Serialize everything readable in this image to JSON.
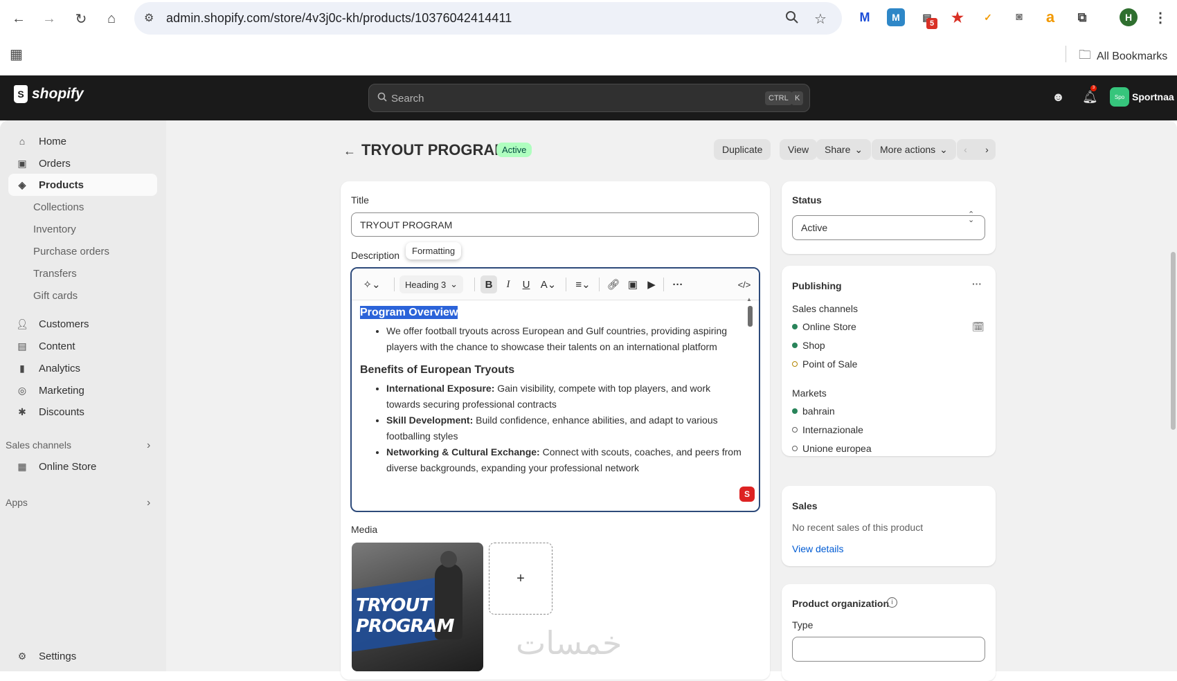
{
  "browser": {
    "url": "admin.shopify.com/store/4v3j0c-kh/products/10376042414411",
    "bookmarks_label": "All Bookmarks",
    "profile_initial": "H",
    "ext_badge": "5"
  },
  "topbar": {
    "brand": "shopify",
    "search_placeholder": "Search",
    "kbd_ctrl": "CTRL",
    "kbd_k": "K",
    "store_avatar": "Spo",
    "store_name": "Sportnaa",
    "notif_count": "3"
  },
  "sidebar": {
    "items": [
      {
        "label": "Home",
        "icon": "home-icon"
      },
      {
        "label": "Orders",
        "icon": "orders-icon"
      },
      {
        "label": "Products",
        "icon": "tag-icon"
      }
    ],
    "sub_items": [
      "Collections",
      "Inventory",
      "Purchase orders",
      "Transfers",
      "Gift cards"
    ],
    "items2": [
      {
        "label": "Customers",
        "icon": "person-icon"
      },
      {
        "label": "Content",
        "icon": "content-icon"
      },
      {
        "label": "Analytics",
        "icon": "analytics-icon"
      },
      {
        "label": "Marketing",
        "icon": "marketing-icon"
      },
      {
        "label": "Discounts",
        "icon": "discount-icon"
      }
    ],
    "sales_channels_label": "Sales channels",
    "online_store": "Online Store",
    "apps_label": "Apps",
    "settings": "Settings"
  },
  "header": {
    "title": "TRYOUT PROGRAM",
    "status_badge": "Active",
    "duplicate": "Duplicate",
    "view": "View",
    "share": "Share",
    "more_actions": "More actions"
  },
  "product": {
    "title_label": "Title",
    "title_value": "TRYOUT PROGRAM",
    "description_label": "Description",
    "tooltip": "Formatting",
    "heading_select": "Heading 3",
    "content": {
      "h1": "Program Overview",
      "p1": "We offer football tryouts across European and Gulf countries, providing aspiring players with the chance to showcase their talents on an international platform",
      "h2": "Benefits of European Tryouts",
      "b1_strong": "International Exposure:",
      "b1_text": " Gain visibility, compete with top players, and work towards securing professional contracts",
      "b2_strong": "Skill Development:",
      "b2_text": " Build confidence, enhance abilities, and adapt to various footballing styles",
      "b3_strong": "Networking & Cultural Exchange:",
      "b3_text": " Connect with scouts, coaches, and peers from diverse backgrounds, expanding your professional network"
    },
    "media_label": "Media",
    "media_image_text_1": "TRYOUT",
    "media_image_text_2": "PROGRAM",
    "add_media": "+"
  },
  "status_card": {
    "label": "Status",
    "value": "Active"
  },
  "publishing": {
    "title": "Publishing",
    "more": "···",
    "sales_channels_label": "Sales channels",
    "channels": [
      {
        "name": "Online Store",
        "state": "active"
      },
      {
        "name": "Shop",
        "state": "active"
      },
      {
        "name": "Point of Sale",
        "state": "partial"
      }
    ],
    "markets_label": "Markets",
    "markets": [
      {
        "name": "bahrain",
        "state": "active"
      },
      {
        "name": "Internazionale",
        "state": "inactive"
      },
      {
        "name": "Unione europea",
        "state": "inactive"
      }
    ]
  },
  "sales": {
    "title": "Sales",
    "text": "No recent sales of this product",
    "link": "View details"
  },
  "organization": {
    "title": "Product organization",
    "type_label": "Type"
  },
  "watermark": "خمسات",
  "colors": {
    "active_green": "#29845a",
    "partial_gold": "#b28400",
    "accent_blue": "#005bd3",
    "topbar": "#1a1a1a"
  }
}
